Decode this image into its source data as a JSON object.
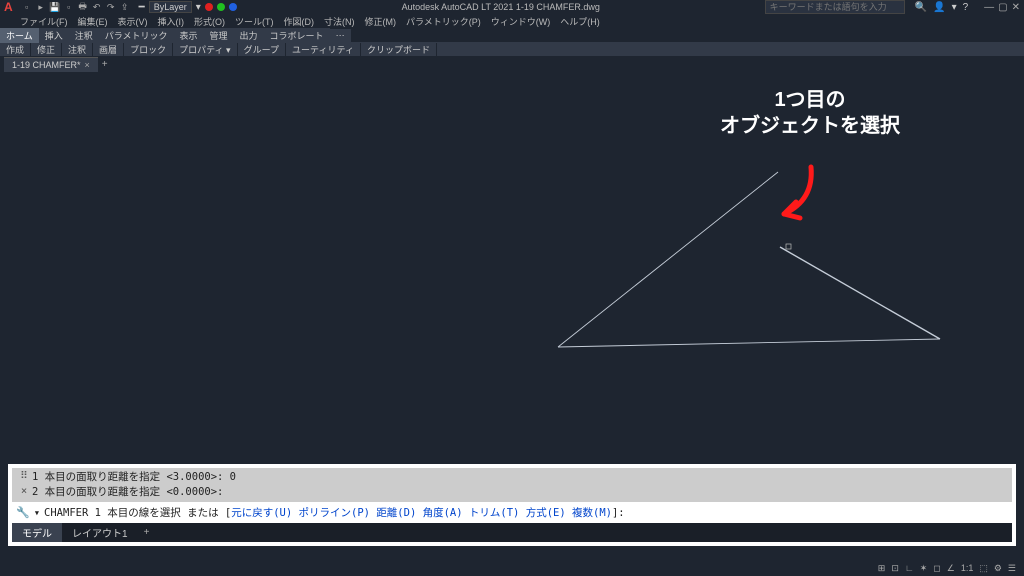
{
  "app": {
    "title": "Autodesk AutoCAD LT 2021   1-19 CHAMFER.dwg",
    "searchPlaceholder": "キーワードまたは語句を入力",
    "layerName": "ByLayer"
  },
  "menu": [
    "ファイル(F)",
    "編集(E)",
    "表示(V)",
    "挿入(I)",
    "形式(O)",
    "ツール(T)",
    "作図(D)",
    "寸法(N)",
    "修正(M)",
    "パラメトリック(P)",
    "ウィンドウ(W)",
    "ヘルプ(H)"
  ],
  "ribbonTabs": [
    "ホーム",
    "挿入",
    "注釈",
    "パラメトリック",
    "表示",
    "管理",
    "出力",
    "コラボレート"
  ],
  "panels": [
    "作成",
    "修正",
    "注釈",
    "画層",
    "ブロック",
    "プロパティ ▾",
    "グループ",
    "ユーティリティ",
    "クリップボード"
  ],
  "docTab": "1-19 CHAMFER*",
  "annotation": {
    "line1": "1つ目の",
    "line2": "オブジェクトを選択"
  },
  "cmd": {
    "hist1": "1 本目の面取り距離を指定 <3.0000>: 0",
    "hist2": "2 本目の面取り距離を指定 <0.0000>:",
    "promptPrefix": "CHAMFER 1 本目の線を選択 または [",
    "opts": [
      "元に戻す(U)",
      "ポリライン(P)",
      "距離(D)",
      "角度(A)",
      "トリム(T)",
      "方式(E)",
      "複数(M)"
    ],
    "promptSuffix": "]:"
  },
  "bottomTabs": {
    "model": "モデル",
    "layout1": "レイアウト1"
  },
  "status": {
    "scale": "1:1"
  }
}
